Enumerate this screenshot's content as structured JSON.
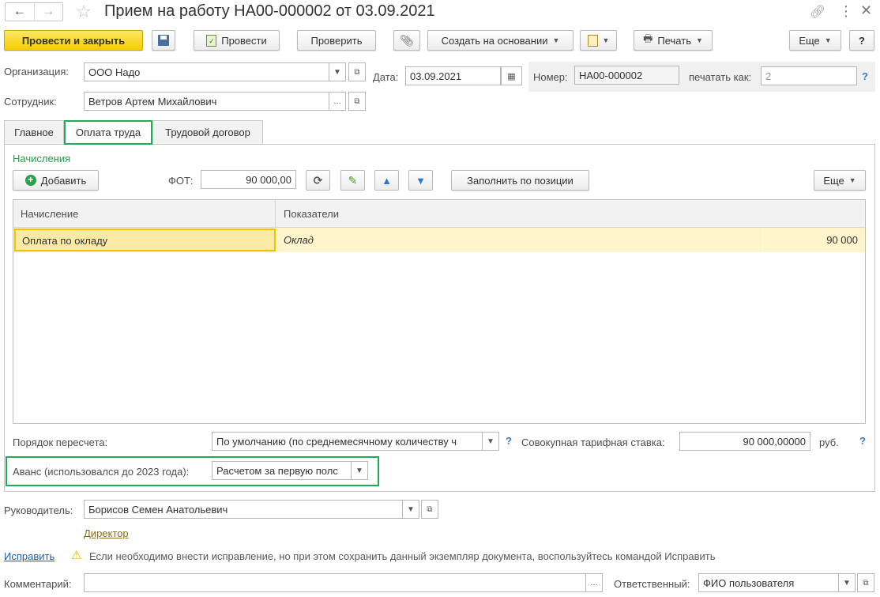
{
  "window": {
    "title": "Прием на работу НА00-000002 от 03.09.2021"
  },
  "toolbar": {
    "post_close": "Провести и закрыть",
    "post": "Провести",
    "check": "Проверить",
    "create_based": "Создать на основании",
    "print": "Печать",
    "more": "Еще",
    "help": "?"
  },
  "header": {
    "org_label": "Организация:",
    "org_value": "ООО Надо",
    "date_label": "Дата:",
    "date_value": "03.09.2021",
    "number_label": "Номер:",
    "number_value": "НА00-000002",
    "print_as_label": "печатать как:",
    "print_as_placeholder": "2",
    "employee_label": "Сотрудник:",
    "employee_value": "Ветров Артем Михайлович"
  },
  "tabs": [
    {
      "label": "Главное"
    },
    {
      "label": "Оплата труда"
    },
    {
      "label": "Трудовой договор"
    }
  ],
  "accruals": {
    "section_title": "Начисления",
    "add_label": "Добавить",
    "fot_label": "ФОТ:",
    "fot_value": "90 000,00",
    "fill_by_position": "Заполнить по позиции",
    "more": "Еще",
    "columns": {
      "accrual": "Начисление",
      "indicators": "Показатели"
    },
    "rows": [
      {
        "accrual": "Оплата по окладу",
        "indicator": "Оклад",
        "value": "90 000"
      }
    ]
  },
  "recalc": {
    "label": "Порядок пересчета:",
    "value": "По умолчанию (по среднемесячному количеству ч",
    "rate_label": "Совокупная тарифная ставка:",
    "rate_value": "90 000,00000",
    "currency": "руб."
  },
  "advance": {
    "label": "Аванс (использовался до 2023 года):",
    "value": "Расчетом за первую полс"
  },
  "manager": {
    "label": "Руководитель:",
    "value": "Борисов Семен Анатольевич",
    "position_link": "Директор"
  },
  "fix": {
    "link": "Исправить",
    "warning": "Если необходимо внести исправление, но при этом сохранить данный экземпляр документа, воспользуйтесь командой Исправить"
  },
  "footer": {
    "comment_label": "Комментарий:",
    "comment_value": "",
    "responsible_label": "Ответственный:",
    "responsible_value": "ФИО пользователя"
  },
  "colors": {
    "accent_green": "#1fab57",
    "primary_yellow": "#f5cd00",
    "selected_row": "#fff4cc",
    "link_blue": "#1f5fa8"
  },
  "icons": [
    "back-arrow-icon",
    "forward-arrow-icon",
    "star-icon",
    "link-icon",
    "more-vertical-icon",
    "close-icon",
    "save-icon",
    "post-doc-icon",
    "paperclip-icon",
    "doc-generate-icon",
    "printer-icon",
    "plus-circle-icon",
    "refresh-icon",
    "pencil-icon",
    "arrow-up-icon",
    "arrow-down-icon",
    "calendar-icon",
    "warning-icon"
  ]
}
